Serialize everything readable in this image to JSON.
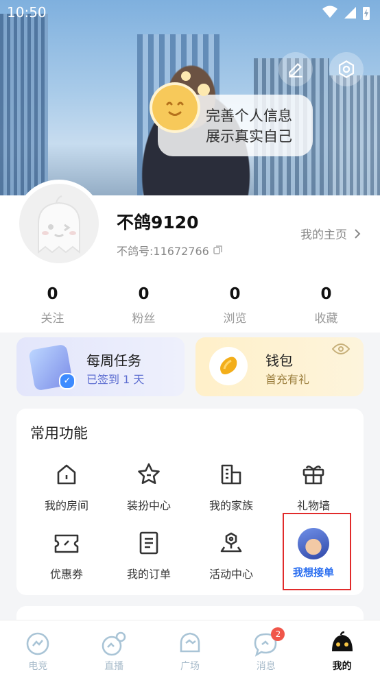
{
  "status_bar": {
    "time": "10:50"
  },
  "banner": {
    "bubble_line1": "完善个人信息",
    "bubble_line2": "展示真实自己"
  },
  "profile": {
    "username": "不鸽9120",
    "user_id": "不鸽号:11672766",
    "homepage_link": "我的主页"
  },
  "stats": [
    {
      "value": "0",
      "label": "关注"
    },
    {
      "value": "0",
      "label": "粉丝"
    },
    {
      "value": "0",
      "label": "浏览"
    },
    {
      "value": "0",
      "label": "收藏"
    }
  ],
  "cards": {
    "task": {
      "title": "每周任务",
      "subtitle": "已签到 1 天"
    },
    "wallet": {
      "title": "钱包",
      "subtitle": "首充有礼"
    }
  },
  "functions": {
    "title": "常用功能",
    "items": [
      {
        "label": "我的房间",
        "icon": "house-icon"
      },
      {
        "label": "装扮中心",
        "icon": "star-icon"
      },
      {
        "label": "我的家族",
        "icon": "building-icon"
      },
      {
        "label": "礼物墙",
        "icon": "gift-icon"
      },
      {
        "label": "优惠券",
        "icon": "ticket-icon"
      },
      {
        "label": "我的订单",
        "icon": "document-icon"
      },
      {
        "label": "活动中心",
        "icon": "location-icon"
      },
      {
        "label": "我想接单",
        "icon": "promo-avatar"
      }
    ]
  },
  "bottom_nav": {
    "items": [
      {
        "label": "电竞"
      },
      {
        "label": "直播"
      },
      {
        "label": "广场"
      },
      {
        "label": "消息",
        "badge": "2"
      },
      {
        "label": "我的"
      }
    ]
  },
  "colors": {
    "highlight_border": "#e12b2b",
    "promo_text": "#2a6ef0",
    "badge": "#f0564a"
  }
}
